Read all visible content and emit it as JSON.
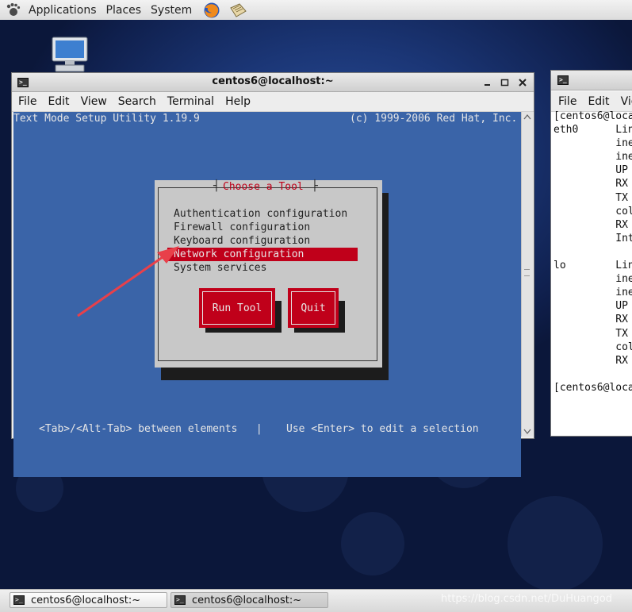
{
  "top_panel": {
    "menus": [
      "Applications",
      "Places",
      "System"
    ]
  },
  "desktop": {
    "icon": "computer-icon"
  },
  "main_window": {
    "title": "centos6@localhost:~",
    "menu": [
      "File",
      "Edit",
      "View",
      "Search",
      "Terminal",
      "Help"
    ],
    "controls": [
      "minimize-icon",
      "maximize-icon",
      "close-icon"
    ]
  },
  "tui": {
    "header_left": "Text Mode Setup Utility 1.19.9",
    "header_right": "(c) 1999-2006 Red Hat, Inc.",
    "dialog_title": "Choose a Tool",
    "items": [
      "Authentication configuration",
      "Firewall configuration",
      "Keyboard configuration",
      "Network configuration",
      "System services"
    ],
    "selected_index": 3,
    "buttons": {
      "run": "Run Tool",
      "quit": "Quit"
    },
    "footer_left": "<Tab>/<Alt-Tab> between elements   |",
    "footer_right": "Use <Enter> to edit a selection"
  },
  "second_window": {
    "menu": [
      "File",
      "Edit",
      "Vie"
    ],
    "lines": [
      "[centos6@loca",
      "eth0      Lin",
      "          ine",
      "          ine",
      "          UP",
      "          RX",
      "          TX",
      "          col",
      "          RX",
      "          Int",
      "",
      "lo        Lin",
      "          ine",
      "          ine",
      "          UP",
      "          RX",
      "          TX",
      "          col",
      "          RX",
      "",
      "[centos6@loca"
    ]
  },
  "taskbar": {
    "items": [
      "centos6@localhost:~",
      "centos6@localhost:~"
    ],
    "watermark": "https://blog.csdn.net/DuHuangod"
  },
  "colors": {
    "tui_bg": "#3a64a8",
    "dialog_bg": "#c8c8c8",
    "selection": "#c0001a",
    "arrow": "#e8404a"
  }
}
